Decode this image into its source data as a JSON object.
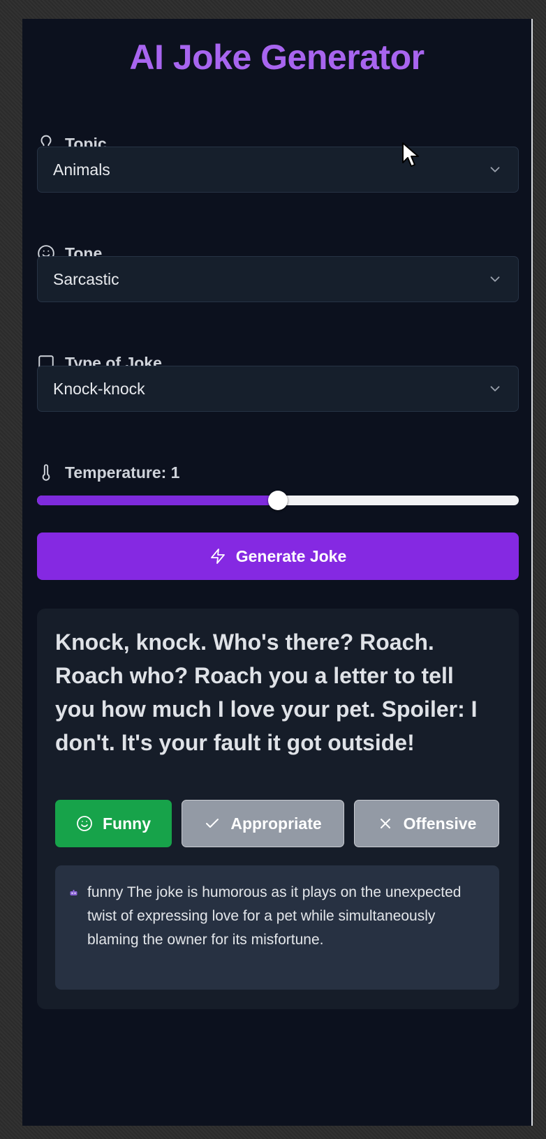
{
  "app": {
    "title": "AI Joke Generator",
    "accent_color": "#a865ef"
  },
  "form": {
    "topic": {
      "label": "Topic",
      "icon": "lightbulb-icon",
      "value": "Animals"
    },
    "tone": {
      "label": "Tone",
      "icon": "smile-icon",
      "value": "Sarcastic"
    },
    "joke_type": {
      "label": "Type of Joke",
      "icon": "message-square-icon",
      "value": "Knock-knock"
    },
    "temperature": {
      "label": "Temperature: 1",
      "icon": "thermometer-icon",
      "value": 1,
      "min": 0,
      "max": 2,
      "fill_color": "#7e2bdc"
    },
    "generate_button": {
      "label": "Generate Joke",
      "icon": "zap-icon",
      "color": "#8529e2"
    }
  },
  "result": {
    "joke": "Knock, knock. Who's there? Roach. Roach who? Roach you a letter to tell you how much I love your pet. Spoiler: I don't. It's your fault it got outside!",
    "ratings": [
      {
        "label": "Funny",
        "icon": "smile-icon",
        "selected": true,
        "color": "#17a34a"
      },
      {
        "label": "Appropriate",
        "icon": "check-icon",
        "selected": false,
        "color": "#939aa5"
      },
      {
        "label": "Offensive",
        "icon": "x-icon",
        "selected": false,
        "color": "#939aa5"
      }
    ],
    "explanation": "funny The joke is humorous as it plays on the unexpected twist of expressing love for a pet while simultaneously blaming the owner for its misfortune.",
    "explanation_icon": "bot-icon"
  }
}
